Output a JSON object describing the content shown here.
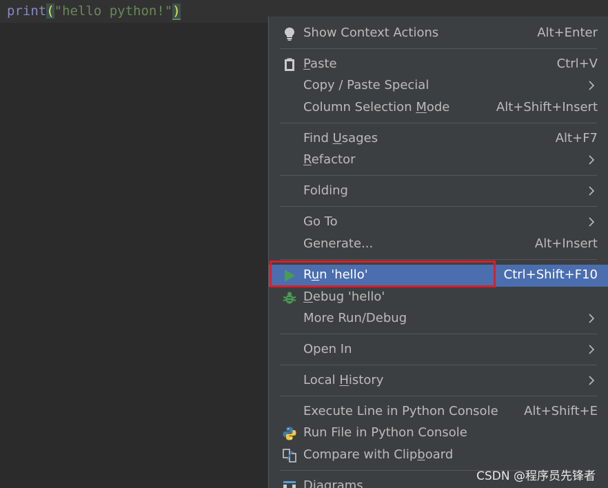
{
  "editor": {
    "code_fn": "print",
    "code_open": "(",
    "code_str": "\"hello python!\"",
    "code_close": ")"
  },
  "menu": {
    "show_context_actions": {
      "label": "Show Context Actions",
      "shortcut": "Alt+Enter",
      "icon": "lightbulb-icon"
    },
    "paste": {
      "label_u": "P",
      "label_rest": "aste",
      "shortcut": "Ctrl+V",
      "icon": "clipboard-icon"
    },
    "copy_paste_special": {
      "label": "Copy / Paste Special"
    },
    "column_selection": {
      "label_pre": "Column Selection ",
      "label_u": "M",
      "label_rest": "ode",
      "shortcut": "Alt+Shift+Insert"
    },
    "find_usages": {
      "label_pre": "Find ",
      "label_u": "U",
      "label_rest": "sages",
      "shortcut": "Alt+F7"
    },
    "refactor": {
      "label_u": "R",
      "label_rest": "efactor"
    },
    "folding": {
      "label": "Folding"
    },
    "go_to": {
      "label": "Go To"
    },
    "generate": {
      "label": "Generate...",
      "shortcut": "Alt+Insert"
    },
    "run": {
      "label_pre": "R",
      "label_u": "u",
      "label_rest": "n 'hello'",
      "shortcut": "Ctrl+Shift+F10",
      "icon": "run-icon"
    },
    "debug": {
      "label_u": "D",
      "label_rest": "ebug 'hello'",
      "icon": "debug-bug-icon"
    },
    "more_run_debug": {
      "label": "More Run/Debug"
    },
    "open_in": {
      "label": "Open In"
    },
    "local_history": {
      "label_pre": "Local ",
      "label_u": "H",
      "label_rest": "istory"
    },
    "execute_line": {
      "label": "Execute Line in Python Console",
      "shortcut": "Alt+Shift+E"
    },
    "run_file_console": {
      "label": "Run File in Python Console",
      "icon": "python-icon"
    },
    "compare_clipboard": {
      "label_pre": "Compare with Clip",
      "label_u": "b",
      "label_rest": "oard",
      "icon": "compare-icon"
    },
    "diagrams": {
      "label": "Diagrams",
      "icon": "diagrams-icon"
    }
  },
  "watermark": "CSDN @程序员先锋者",
  "colors": {
    "selection": "#4b6eaf",
    "menu_bg": "#3c3f41",
    "highlight_border": "#d8202a",
    "run_icon": "#499c54"
  }
}
